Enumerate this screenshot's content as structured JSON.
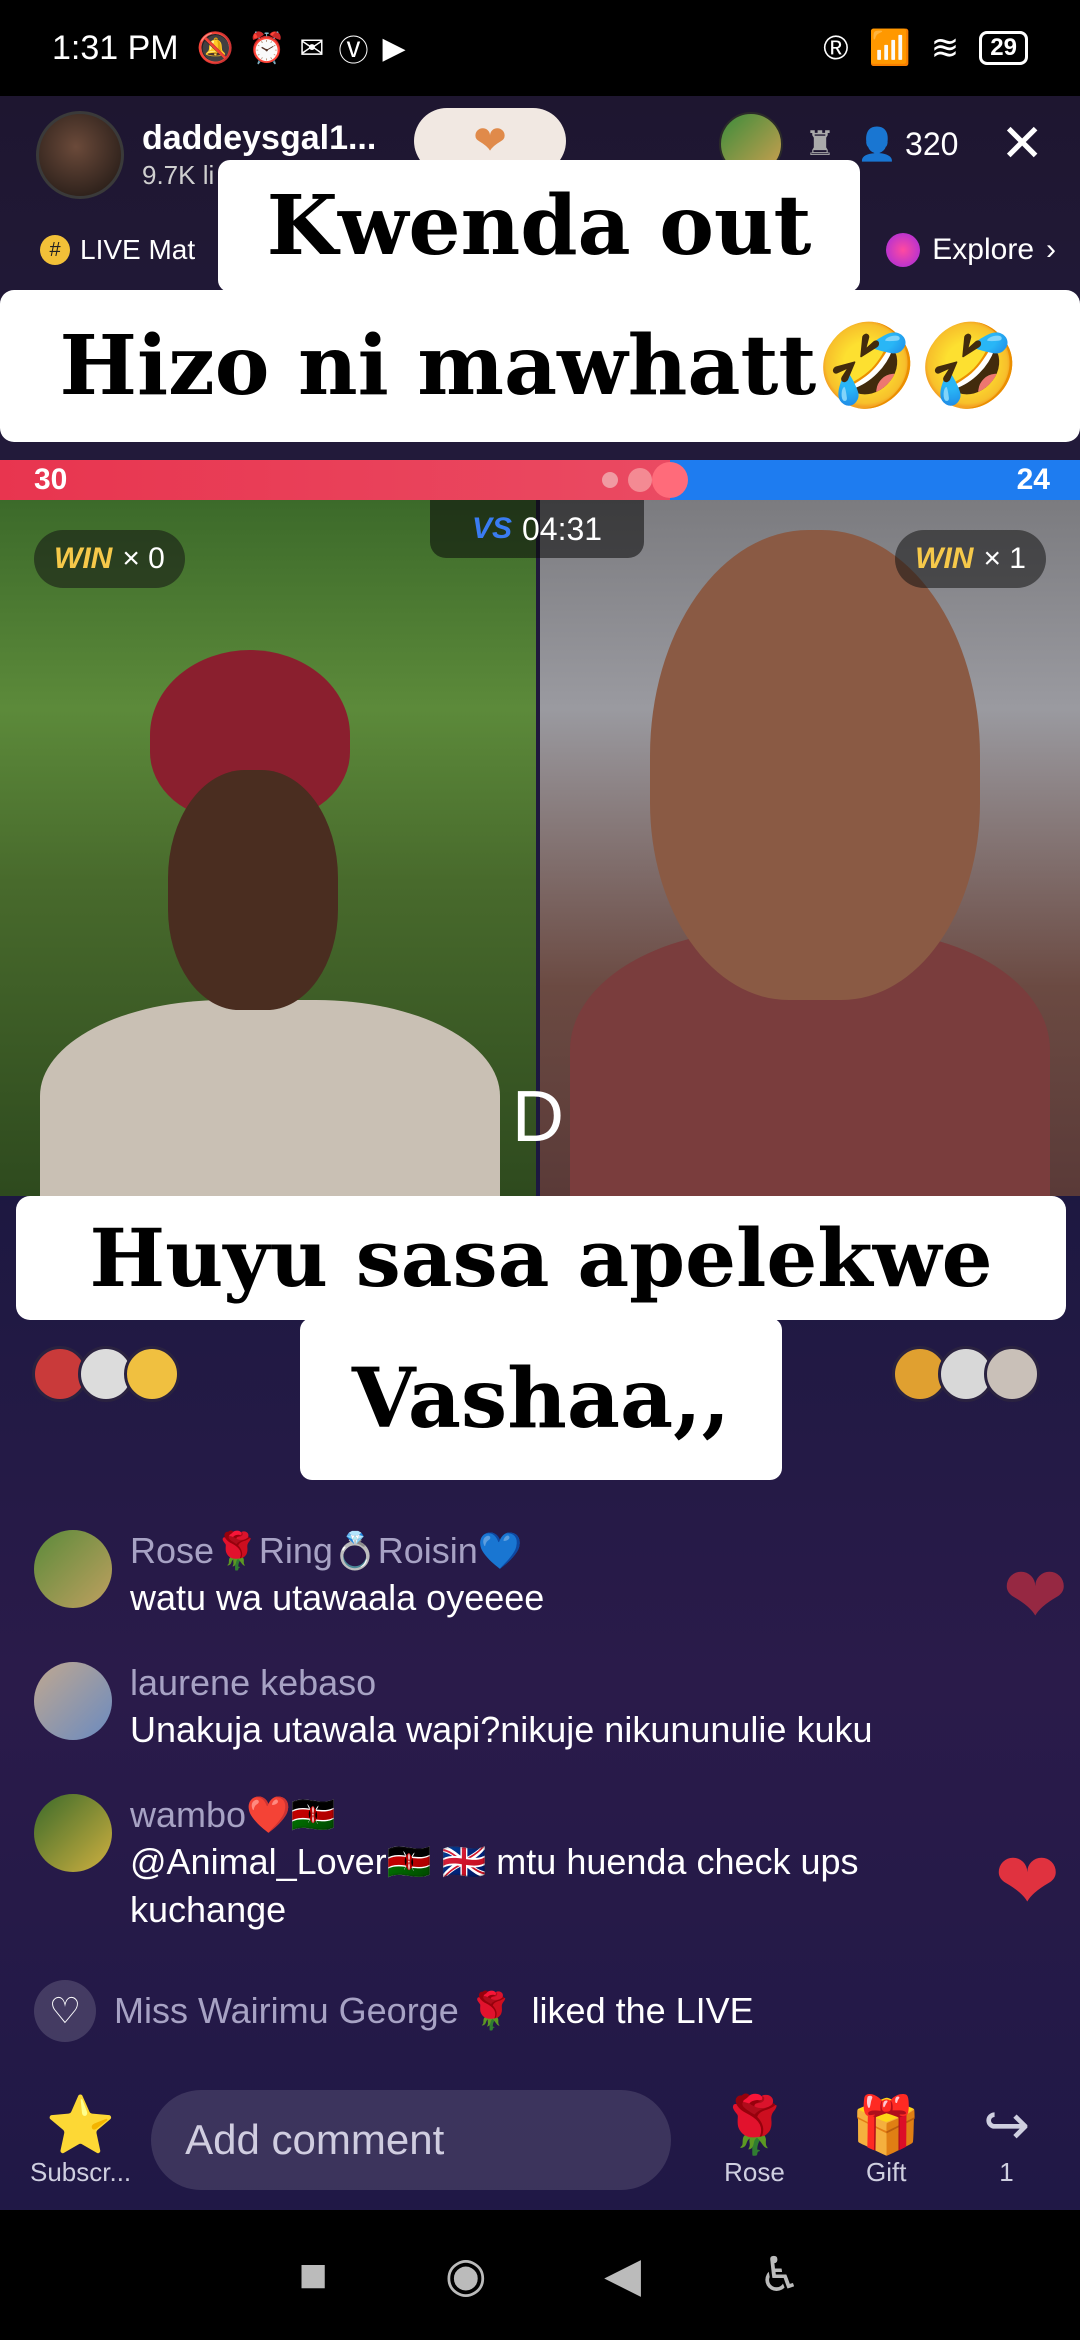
{
  "status_bar": {
    "time": "1:31 PM",
    "battery": "29"
  },
  "header": {
    "host_name": "daddeysgal1...",
    "host_likes": "9.7K li",
    "viewer_count": "320",
    "live_match": "LIVE Mat",
    "explore": "Explore"
  },
  "captions": {
    "line1": "Kwenda out",
    "line2": "Hizo ni mawhatt🤣🤣",
    "line3": "Huyu sasa apelekwe",
    "line4": "Vashaa,,"
  },
  "battle": {
    "score_left": "30",
    "score_right": "24",
    "timer": "04:31",
    "vs": "VS",
    "win_label": "WIN",
    "win_left": "× 0",
    "win_right": "× 1",
    "overlay_letter": "D"
  },
  "comments": [
    {
      "name": "Rose🌹Ring💍Roisin💙",
      "text": "watu wa utawaala oyeeee"
    },
    {
      "name": "laurene kebaso",
      "text": "Unakuja utawala wapi?nikuje nikununulie kuku"
    },
    {
      "name": "wambo❤️🇰🇪",
      "text": "@Animal_Lover🇰🇪 🇬🇧 mtu huenda check ups kuchange"
    }
  ],
  "liked": {
    "who": "Miss Wairimu George 🌹",
    "action": "liked the LIVE"
  },
  "bottom": {
    "subscribe": "Subscr...",
    "comment_placeholder": "Add comment",
    "rose": "Rose",
    "gift": "Gift",
    "share_count": "1"
  }
}
